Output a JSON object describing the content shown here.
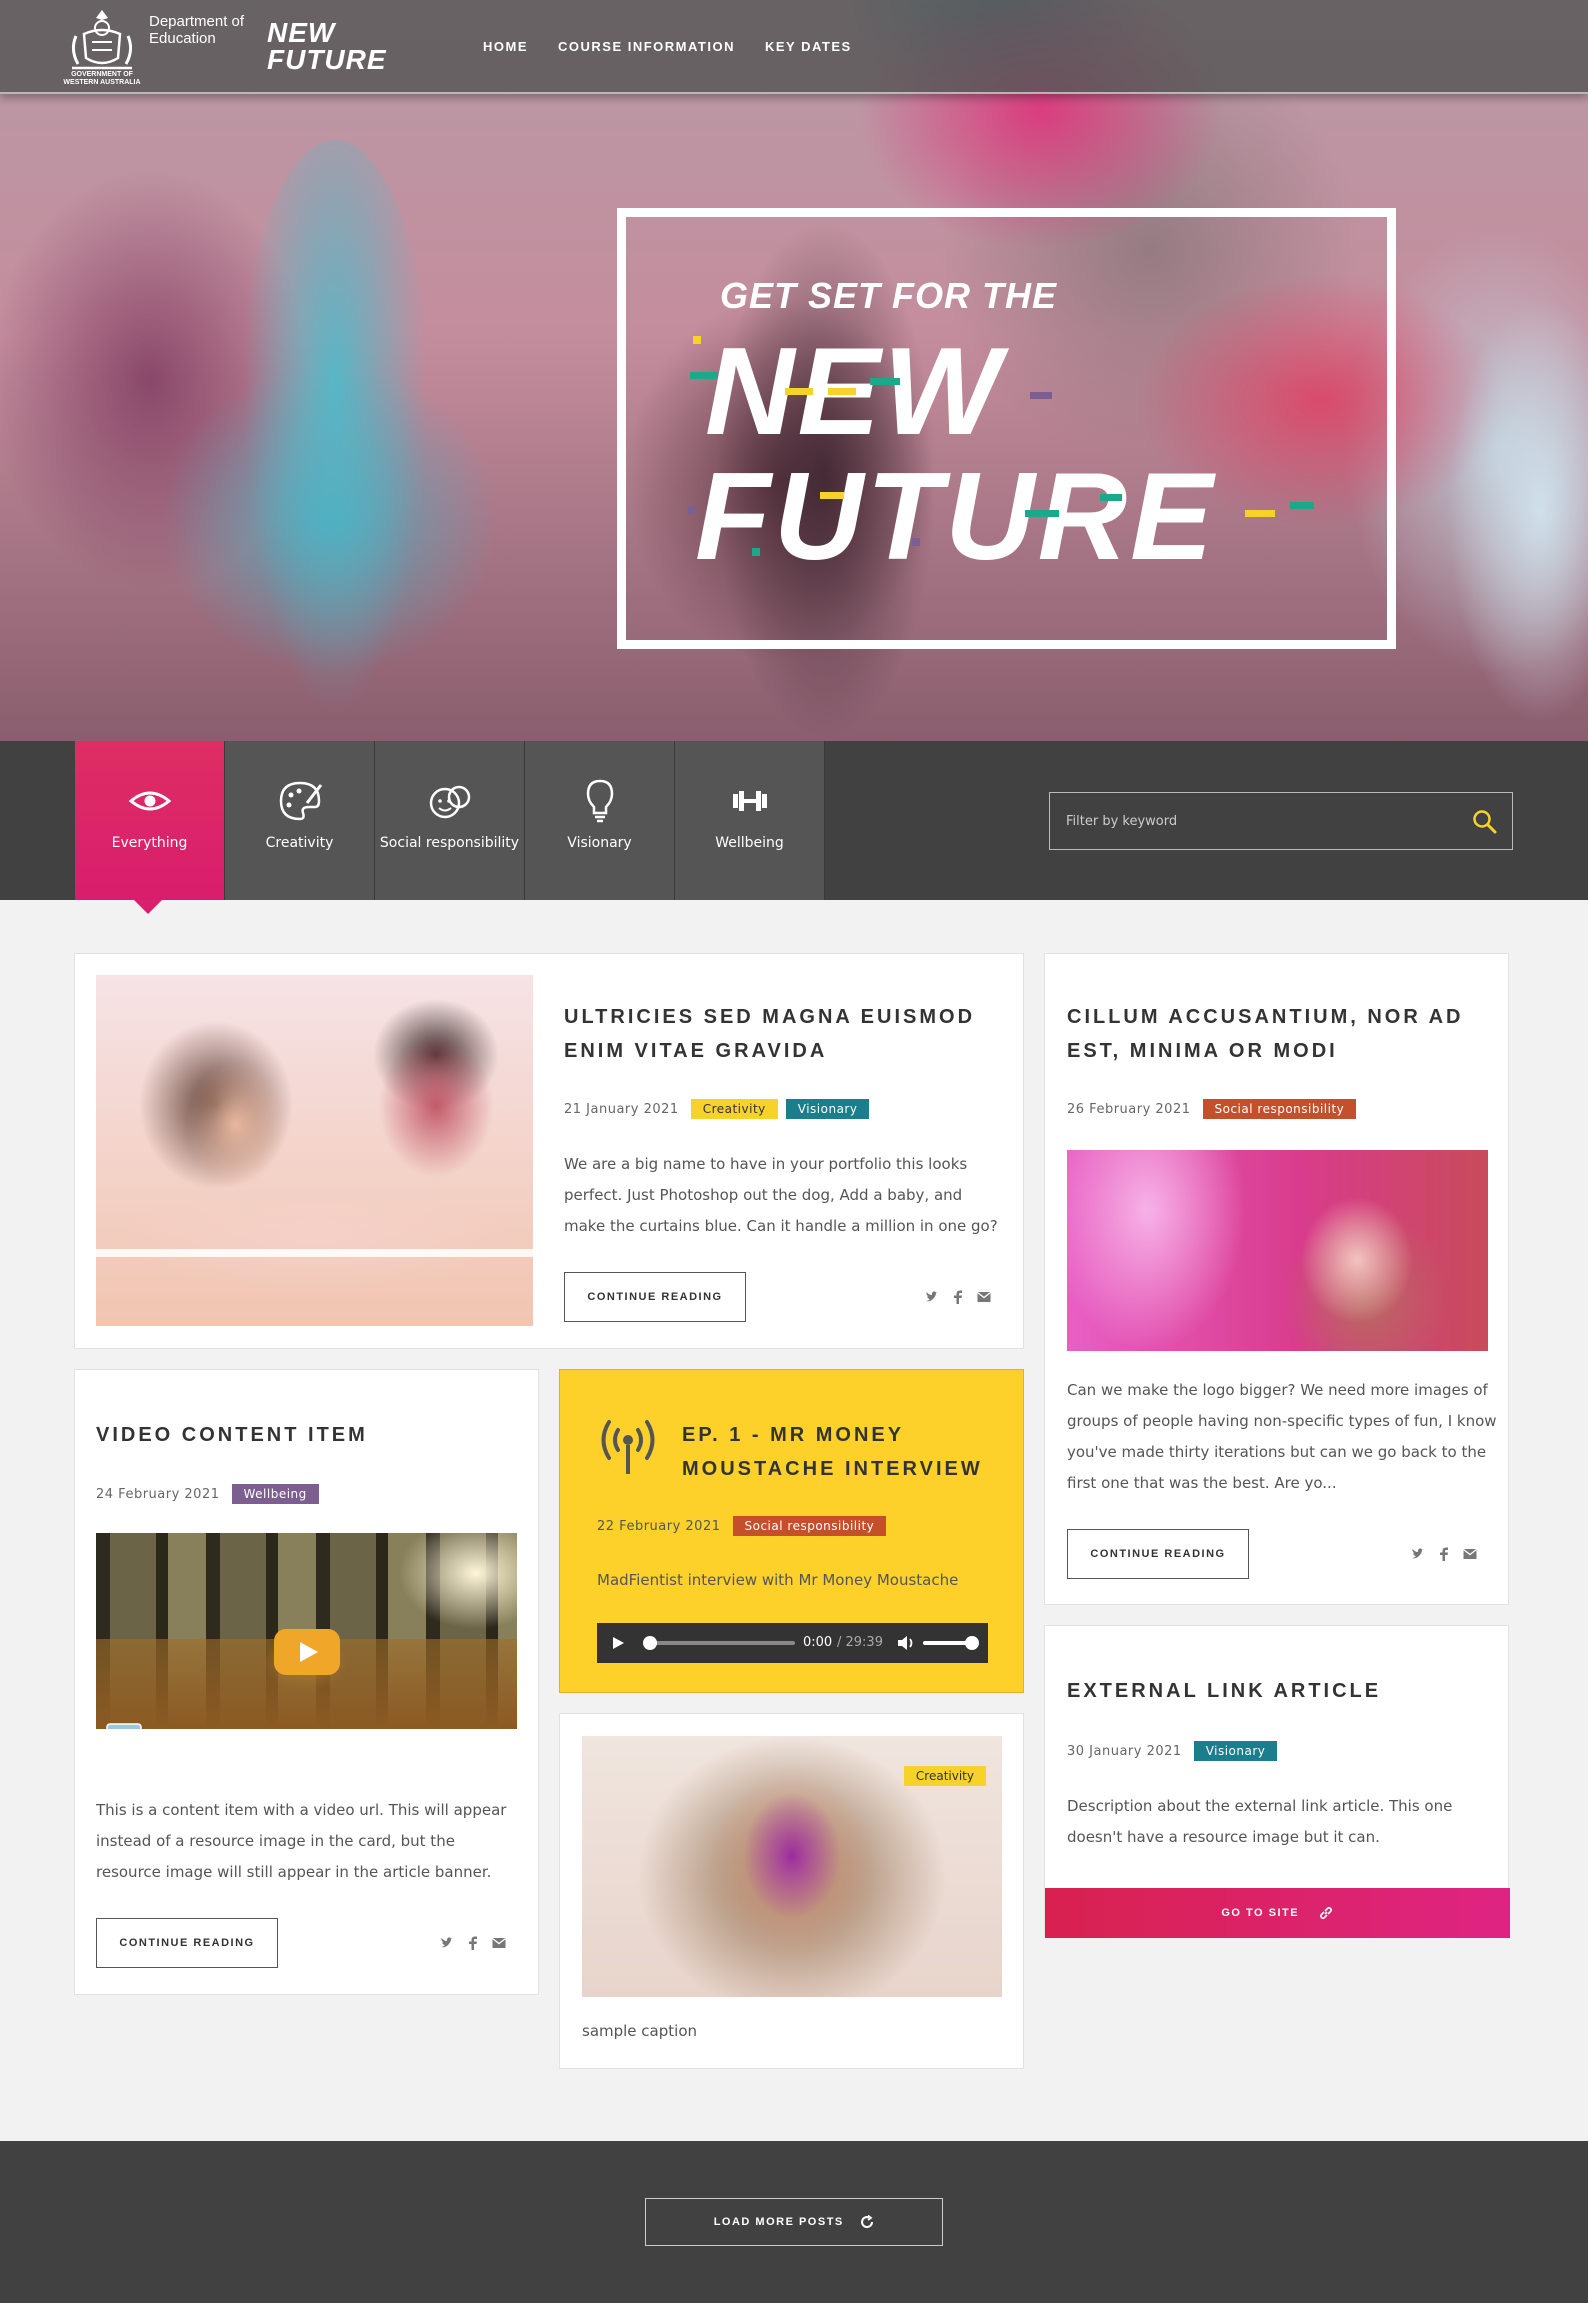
{
  "header": {
    "dept_line1": "Department of",
    "dept_line2": "Education",
    "crest_caption": "GOVERNMENT OF WESTERN AUSTRALIA",
    "logo_line1": "NEW",
    "logo_line2": "FUTURE",
    "nav": [
      "HOME",
      "COURSE INFORMATION",
      "KEY DATES"
    ]
  },
  "hero": {
    "subtitle": "GET SET FOR THE",
    "title_line1": "NEW",
    "title_line2": "FUTURE"
  },
  "filters": {
    "tabs": [
      {
        "label": "Everything",
        "icon": "eye-icon",
        "active": true
      },
      {
        "label": "Creativity",
        "icon": "palette-icon",
        "active": false
      },
      {
        "label": "Social responsibility",
        "icon": "faces-icon",
        "active": false
      },
      {
        "label": "Visionary",
        "icon": "lightbulb-icon",
        "active": false
      },
      {
        "label": "Wellbeing",
        "icon": "dumbbell-icon",
        "active": false
      }
    ],
    "search_placeholder": "Filter by keyword",
    "search_icon": "search-icon"
  },
  "colors": {
    "accent_pink": "#da1f6c",
    "creativity": "#f7d22a",
    "visionary": "#1a7e8c",
    "social": "#c4502b",
    "wellbeing": "#7d5e91",
    "podcast_bg": "#fdd12a"
  },
  "cards": {
    "featured": {
      "title": "ULTRICIES SED MAGNA EUISMOD ENIM VITAE GRAVIDA",
      "date": "21 January 2021",
      "tags": [
        "Creativity",
        "Visionary"
      ],
      "text": "We are a big name to have in your portfolio this looks perfect. Just Photoshop out the dog, Add a baby, and make the curtains blue. Can it handle a million in one go?",
      "button": "CONTINUE READING"
    },
    "cillum": {
      "title": "CILLUM ACCUSANTIUM, NOR AD EST, MINIMA OR MODI",
      "date": "26 February 2021",
      "tag": "Social responsibility",
      "text": "Can we make the logo bigger? We need more images of groups of people having non-specific types of fun, I know you've made thirty iterations but can we go back to the first one that was the best. Are yo...",
      "button": "CONTINUE READING"
    },
    "video": {
      "title": "VIDEO CONTENT ITEM",
      "date": "24 February 2021",
      "tag": "Wellbeing",
      "text": "This is a content item with a video url. This will appear instead of a resource image in the card, but the resource image will still appear in the article banner.",
      "button": "CONTINUE READING"
    },
    "podcast": {
      "title": "EP. 1 - MR MONEY MOUSTACHE INTERVIEW",
      "date": "22 February 2021",
      "tag": "Social responsibility",
      "text": "MadFientist interview with Mr Money Moustache",
      "time_current": "0:00",
      "time_total": "/ 29:39",
      "progress": 0
    },
    "image": {
      "tag": "Creativity",
      "caption": "sample caption"
    },
    "external": {
      "title": "EXTERNAL LINK ARTICLE",
      "date": "30 January 2021",
      "tag": "Visionary",
      "text": "Description about the external link article. This one doesn't have a resource image but it can.",
      "button": "GO TO SITE"
    }
  },
  "footer": {
    "load_more": "LOAD MORE POSTS"
  }
}
